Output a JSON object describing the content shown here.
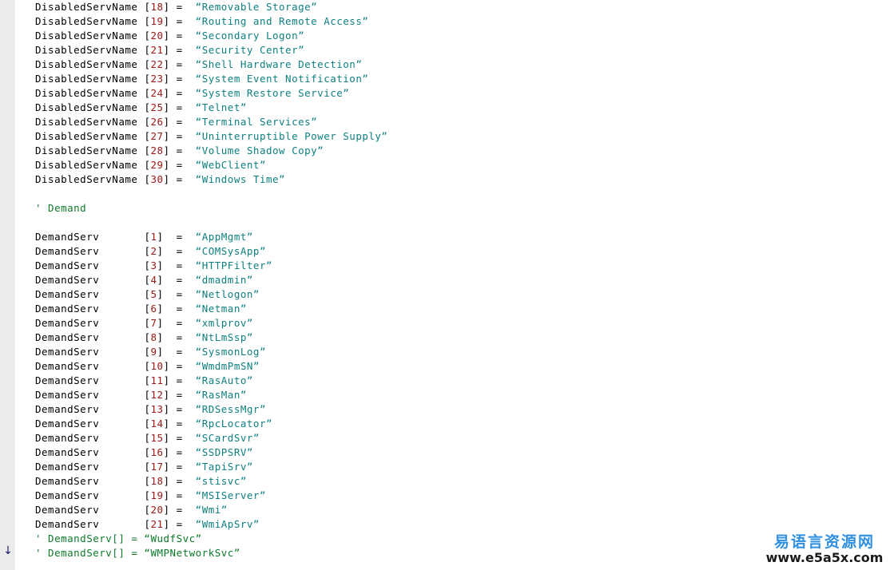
{
  "editor": {
    "gutter_marker_icon": "down-arrow-icon",
    "gutter_marker_glyph": "↓",
    "line_height": 18,
    "first_line_top": 0,
    "colors": {
      "background": "#ffffff",
      "gutter": "#ebebeb",
      "identifier": "#000000",
      "number": "#a01818",
      "string": "#0f8080",
      "comment": "#0a7a28",
      "watermark_cn": "#2f8fe0",
      "watermark_url": "#1a1a1a"
    }
  },
  "code_lines": [
    {
      "kind": "assign",
      "name": "DisabledServName",
      "index": "18",
      "value": "Removable Storage"
    },
    {
      "kind": "assign",
      "name": "DisabledServName",
      "index": "19",
      "value": "Routing and Remote Access"
    },
    {
      "kind": "assign",
      "name": "DisabledServName",
      "index": "20",
      "value": "Secondary Logon"
    },
    {
      "kind": "assign",
      "name": "DisabledServName",
      "index": "21",
      "value": "Security Center"
    },
    {
      "kind": "assign",
      "name": "DisabledServName",
      "index": "22",
      "value": "Shell Hardware Detection"
    },
    {
      "kind": "assign",
      "name": "DisabledServName",
      "index": "23",
      "value": "System Event Notification"
    },
    {
      "kind": "assign",
      "name": "DisabledServName",
      "index": "24",
      "value": "System Restore Service"
    },
    {
      "kind": "assign",
      "name": "DisabledServName",
      "index": "25",
      "value": "Telnet"
    },
    {
      "kind": "assign",
      "name": "DisabledServName",
      "index": "26",
      "value": "Terminal Services"
    },
    {
      "kind": "assign",
      "name": "DisabledServName",
      "index": "27",
      "value": "Uninterruptible Power Supply"
    },
    {
      "kind": "assign",
      "name": "DisabledServName",
      "index": "28",
      "value": "Volume Shadow Copy"
    },
    {
      "kind": "assign",
      "name": "DisabledServName",
      "index": "29",
      "value": "WebClient"
    },
    {
      "kind": "assign",
      "name": "DisabledServName",
      "index": "30",
      "value": "Windows Time"
    },
    {
      "kind": "blank"
    },
    {
      "kind": "comment",
      "text": "' Demand"
    },
    {
      "kind": "blank"
    },
    {
      "kind": "assign",
      "name": "DemandServ",
      "index": "1",
      "value": "AppMgmt"
    },
    {
      "kind": "assign",
      "name": "DemandServ",
      "index": "2",
      "value": "COMSysApp"
    },
    {
      "kind": "assign",
      "name": "DemandServ",
      "index": "3",
      "value": "HTTPFilter"
    },
    {
      "kind": "assign",
      "name": "DemandServ",
      "index": "4",
      "value": "dmadmin"
    },
    {
      "kind": "assign",
      "name": "DemandServ",
      "index": "5",
      "value": "Netlogon"
    },
    {
      "kind": "assign",
      "name": "DemandServ",
      "index": "6",
      "value": "Netman"
    },
    {
      "kind": "assign",
      "name": "DemandServ",
      "index": "7",
      "value": "xmlprov"
    },
    {
      "kind": "assign",
      "name": "DemandServ",
      "index": "8",
      "value": "NtLmSsp"
    },
    {
      "kind": "assign",
      "name": "DemandServ",
      "index": "9",
      "value": "SysmonLog"
    },
    {
      "kind": "assign",
      "name": "DemandServ",
      "index": "10",
      "value": "WmdmPmSN"
    },
    {
      "kind": "assign",
      "name": "DemandServ",
      "index": "11",
      "value": "RasAuto"
    },
    {
      "kind": "assign",
      "name": "DemandServ",
      "index": "12",
      "value": "RasMan"
    },
    {
      "kind": "assign",
      "name": "DemandServ",
      "index": "13",
      "value": "RDSessMgr"
    },
    {
      "kind": "assign",
      "name": "DemandServ",
      "index": "14",
      "value": "RpcLocator"
    },
    {
      "kind": "assign",
      "name": "DemandServ",
      "index": "15",
      "value": "SCardSvr"
    },
    {
      "kind": "assign",
      "name": "DemandServ",
      "index": "16",
      "value": "SSDPSRV"
    },
    {
      "kind": "assign",
      "name": "DemandServ",
      "index": "17",
      "value": "TapiSrv"
    },
    {
      "kind": "assign",
      "name": "DemandServ",
      "index": "18",
      "value": "stisvc"
    },
    {
      "kind": "assign",
      "name": "DemandServ",
      "index": "19",
      "value": "MSIServer"
    },
    {
      "kind": "assign",
      "name": "DemandServ",
      "index": "20",
      "value": "Wmi"
    },
    {
      "kind": "assign",
      "name": "DemandServ",
      "index": "21",
      "value": "WmiApSrv"
    },
    {
      "kind": "comment",
      "text": "' DemandServ[] = “WudfSvc”"
    },
    {
      "kind": "comment",
      "text": "' DemandServ[] = “WMPNetworkSvc”"
    }
  ],
  "watermark": {
    "cn": "易语言资源网",
    "url": "www.e5a5x.com"
  }
}
